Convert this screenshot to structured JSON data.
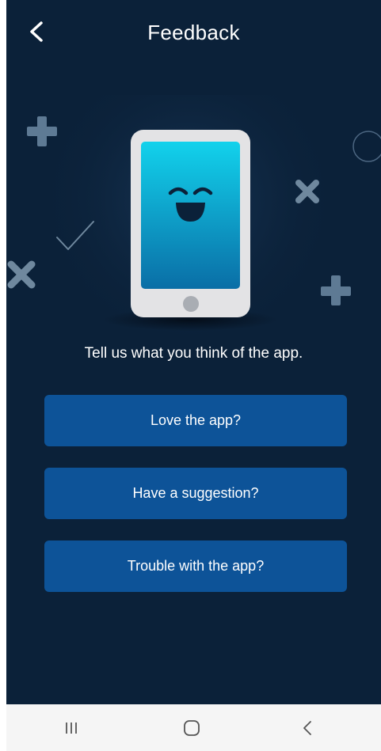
{
  "header": {
    "title": "Feedback",
    "back_icon": "chevron-left-icon"
  },
  "illustration": {
    "subject": "smiling-phone-illustration",
    "decorations": [
      "plus-icon",
      "circle-icon",
      "times-icon",
      "check-icon",
      "times-icon",
      "plus-icon"
    ]
  },
  "main": {
    "prompt": "Tell us what you think of the app.",
    "options": [
      {
        "label": "Love the app?"
      },
      {
        "label": "Have a suggestion?"
      },
      {
        "label": "Trouble with the app?"
      }
    ]
  },
  "navbar": {
    "items": [
      "recent-apps-icon",
      "home-icon",
      "back-icon"
    ]
  },
  "colors": {
    "background": "#0b2139",
    "button": "#0d5398",
    "text": "#ffffff",
    "navbar_bg": "#f5f5f5"
  }
}
